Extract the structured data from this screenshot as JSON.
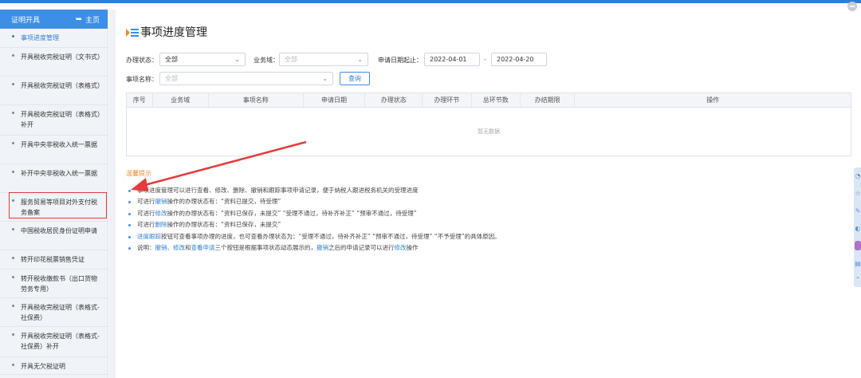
{
  "sidebar": {
    "header_label": "证明开具",
    "home_label": "主页",
    "items": [
      {
        "label": "事项进度管理"
      },
      {
        "label": "开具税收完税证明（文书式）"
      },
      {
        "label": "开具税收完税证明（表格式）"
      },
      {
        "label": "开具税收完税证明（表格式）补开"
      },
      {
        "label": "开具中央非税收入统一票据"
      },
      {
        "label": "补开中央非税收入统一票据"
      },
      {
        "label": "服务贸易等项目对外支付税务备案"
      },
      {
        "label": "中国税收居民身份证明申请"
      },
      {
        "label": "转开印花税票销售凭证"
      },
      {
        "label": "转开税收缴款书（出口货物劳务专用）"
      },
      {
        "label": "开具税收完税证明（表格式-社保费）"
      },
      {
        "label": "开具税收完税证明（表格式-社保费）补开"
      },
      {
        "label": "开具无欠税证明"
      }
    ]
  },
  "main": {
    "title": "事项进度管理",
    "form": {
      "status_label": "办理状态：",
      "status_value": "全部",
      "domain_label": "业务域：",
      "domain_value": "全部",
      "date_label": "申请日期起止：",
      "date_start": "2022-04-01",
      "date_sep": "-",
      "date_end": "2022-04-20",
      "item_label": "事项名称：",
      "item_value": "全部",
      "query_label": "查询"
    },
    "table": {
      "columns": [
        "序号",
        "业务域",
        "事项名称",
        "申请日期",
        "办理状态",
        "办理环节",
        "总环节数",
        "办结期限",
        "操作"
      ],
      "empty_text": "暂无数据"
    },
    "tips": {
      "title": "温馨提示",
      "lines": [
        {
          "parts": [
            "事项进度管理可以进行查看、修改、删除、撤销和跟踪事项申请记录，便于纳税人跟进税务机关的受理进度"
          ]
        },
        {
          "parts": [
            "可进行",
            "撤销",
            "操作的办理状态有：“资料已提交，待受理”"
          ]
        },
        {
          "parts": [
            "可进行",
            "修改",
            "操作的办理状态有：“资料已保存，未提交” “受理不通过，待补齐补正” “预审不通过，待受理”"
          ]
        },
        {
          "parts": [
            "可进行",
            "删除",
            "操作的办理状态有：“资料已保存，未提交”"
          ]
        },
        {
          "parts": [
            "",
            "进度跟踪",
            "按钮可查看事项办理的进度，也可查看办理状态为：“受理不通过，待补齐补正” “预审不通过，待受理” “不予受理”的具体原因。"
          ]
        },
        {
          "parts": [
            "说明：",
            "撤销、修改",
            "和",
            "查看申请",
            "三个按钮是根据事项状态动态展示的，",
            "撤销",
            "之后的申请记录可以进行",
            "修改",
            "操作"
          ]
        }
      ]
    }
  },
  "colors": {
    "accent": "#3d8ee6",
    "tip_title": "#f08a24",
    "annotation_red": "#e53b3b"
  }
}
